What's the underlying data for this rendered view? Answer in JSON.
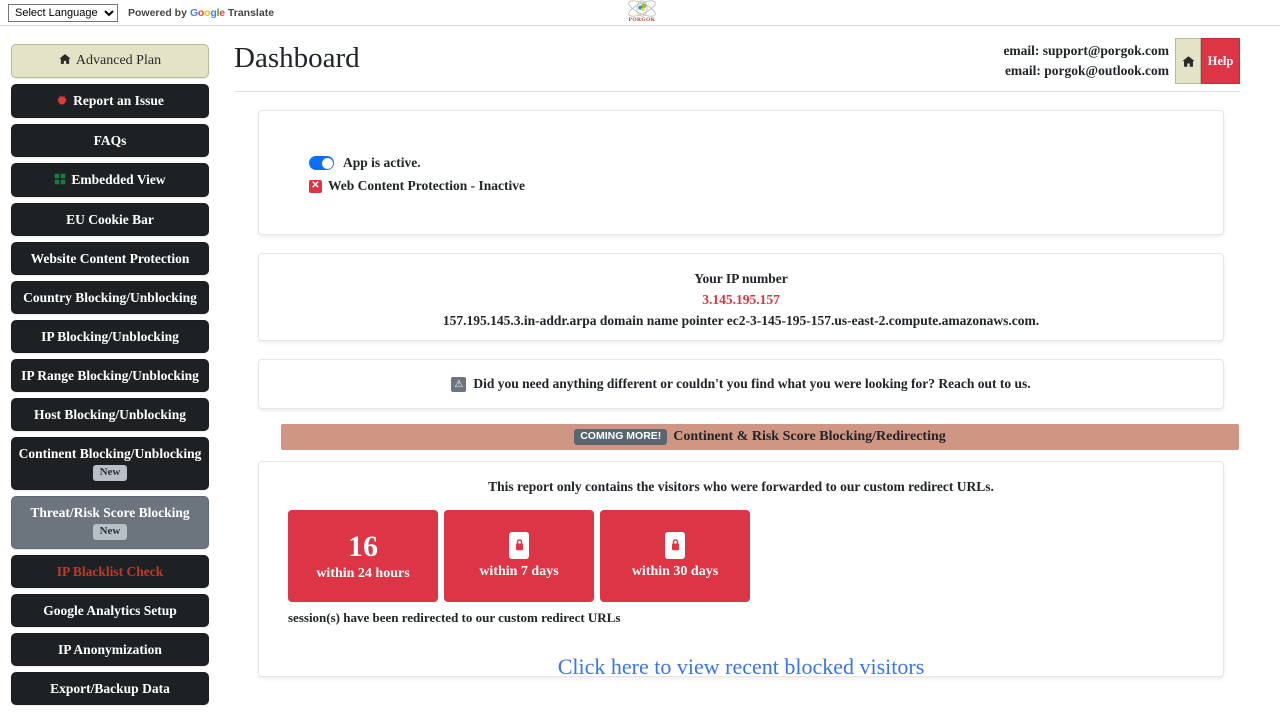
{
  "translate_bar": {
    "select_value": "Select Language",
    "options": [
      "Select Language"
    ],
    "powered_by": "Powered by",
    "google_letters": [
      "G",
      "o",
      "o",
      "g",
      "l",
      "e"
    ],
    "translate_label": "Translate"
  },
  "brand": {
    "name": "PORGOK",
    "logo_icon": "porgok-atom-logo"
  },
  "sidebar": {
    "items": [
      {
        "label": "Advanced Plan",
        "icon": "home-icon",
        "style": "plan",
        "badge": null
      },
      {
        "label": "Report an Issue",
        "icon": "bug-icon",
        "style": "dark",
        "badge": null
      },
      {
        "label": "FAQs",
        "icon": null,
        "style": "dark",
        "badge": null
      },
      {
        "label": "Embedded View",
        "icon": "grid-icon",
        "style": "dark",
        "badge": null
      },
      {
        "label": "EU Cookie Bar",
        "icon": null,
        "style": "dark",
        "badge": null
      },
      {
        "label": "Website Content Protection",
        "icon": null,
        "style": "dark",
        "badge": null
      },
      {
        "label": "Country Blocking/Unblocking",
        "icon": null,
        "style": "dark",
        "badge": null
      },
      {
        "label": "IP Blocking/Unblocking",
        "icon": null,
        "style": "dark",
        "badge": null
      },
      {
        "label": "IP Range Blocking/Unblocking",
        "icon": null,
        "style": "dark",
        "badge": null
      },
      {
        "label": "Host Blocking/Unblocking",
        "icon": null,
        "style": "dark",
        "badge": null
      },
      {
        "label": "Continent Blocking/Unblocking",
        "icon": null,
        "style": "dark",
        "badge": "New"
      },
      {
        "label": "Threat/Risk Score Blocking",
        "icon": null,
        "style": "muted",
        "badge": "New"
      },
      {
        "label": "IP Blacklist Check",
        "icon": null,
        "style": "dark-red-text",
        "badge": null
      },
      {
        "label": "Google Analytics Setup",
        "icon": null,
        "style": "dark",
        "badge": null
      },
      {
        "label": "IP Anonymization",
        "icon": null,
        "style": "dark",
        "badge": null
      },
      {
        "label": "Export/Backup Data",
        "icon": null,
        "style": "dark",
        "badge": null
      }
    ]
  },
  "header": {
    "title": "Dashboard",
    "email_support": "email: support@porgok.com",
    "email_outlook": "email: porgok@outlook.com",
    "home_icon": "home-icon",
    "help_label": "Help"
  },
  "status_card": {
    "toggle_on": true,
    "app_status": "App is active.",
    "protection_status": "Web Content Protection - Inactive",
    "x_mark": "✕"
  },
  "ip_card": {
    "label": "Your IP number",
    "value": "3.145.195.157",
    "pointer": "157.195.145.3.in-addr.arpa domain name pointer ec2-3-145-195-157.us-east-2.compute.amazonaws.com."
  },
  "reach_card": {
    "warn_icon": "warning-triangle-icon",
    "warn_glyph": "⚠",
    "text": "Did you need anything different or couldn't you find what you were looking for? Reach out to us."
  },
  "coming_banner": {
    "pill": "COMING MORE!",
    "text": "Continent & Risk Score Blocking/Redirecting"
  },
  "report_card": {
    "note": "This report only contains the visitors who were forwarded to our custom redirect URLs.",
    "stats": [
      {
        "value": "16",
        "locked": false,
        "label": "within 24 hours"
      },
      {
        "value": null,
        "locked": true,
        "label": "within 7 days"
      },
      {
        "value": null,
        "locked": true,
        "label": "within 30 days"
      }
    ],
    "sessions_note": "session(s) have been redirected to our custom redirect URLs",
    "view_link": "Click here to view recent blocked visitors"
  },
  "colors": {
    "accent_red": "#dc3545",
    "plan_beige": "#e3e3c7",
    "sidebar_dark": "#1d2124",
    "sidebar_muted": "#6c757d",
    "banner_peach": "#cf9783",
    "link_blue": "#3b74e8",
    "toggle_blue": "#0d6efd"
  }
}
